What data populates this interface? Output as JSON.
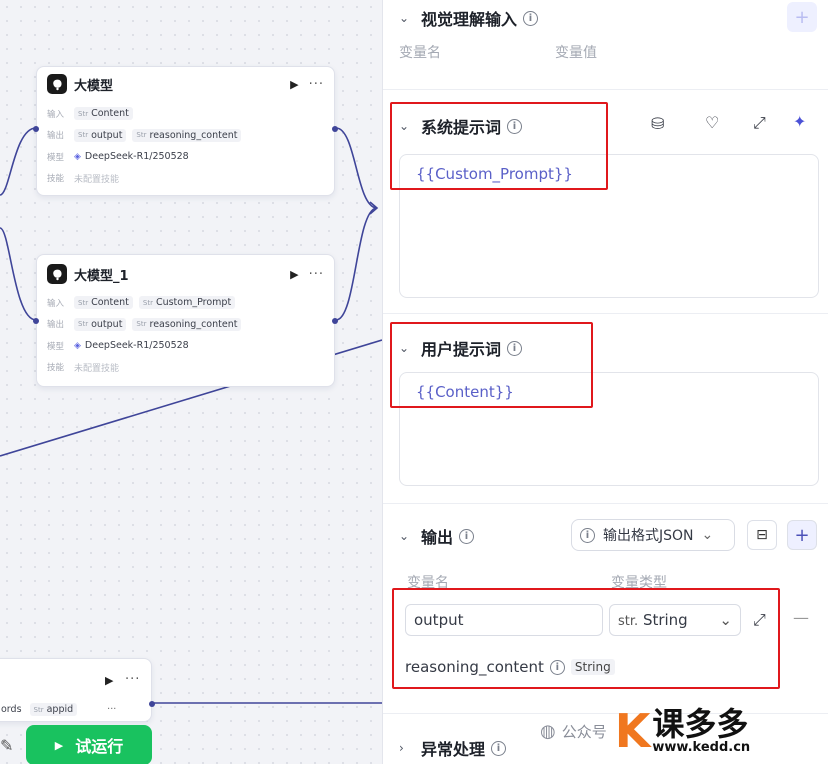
{
  "canvas": {
    "node1": {
      "title": "大模型",
      "row_input_label": "输入",
      "row_output_label": "输出",
      "row_model_label": "模型",
      "row_skill_label": "技能",
      "input_tags": [
        {
          "type": "Str",
          "name": "Content"
        }
      ],
      "output_tags": [
        {
          "type": "Str",
          "name": "output"
        },
        {
          "type": "Str",
          "name": "reasoning_content"
        }
      ],
      "model": "DeepSeek-R1/250528",
      "skill": "未配置技能"
    },
    "node2": {
      "title": "大模型_1",
      "row_input_label": "输入",
      "row_output_label": "输出",
      "row_model_label": "模型",
      "row_skill_label": "技能",
      "input_tags": [
        {
          "type": "Str",
          "name": "Content"
        },
        {
          "type": "Str",
          "name": "Custom_Prompt"
        }
      ],
      "output_tags": [
        {
          "type": "Str",
          "name": "output"
        },
        {
          "type": "Str",
          "name": "reasoning_content"
        }
      ],
      "model": "DeepSeek-R1/250528",
      "skill": "未配置技能"
    },
    "bottom_node": {
      "row_left": "ords",
      "tag": {
        "type": "Str",
        "name": "appid"
      }
    },
    "run_button": "试运行"
  },
  "panel": {
    "vision": {
      "title": "视觉理解输入",
      "col_name": "变量名",
      "col_value": "变量值"
    },
    "system_prompt": {
      "title": "系统提示词",
      "value": "{{Custom_Prompt}}",
      "tools": [
        "library-icon",
        "bulb-icon",
        "expand-icon",
        "sparkle-icon"
      ]
    },
    "user_prompt": {
      "title": "用户提示词",
      "value": "{{Content}}"
    },
    "output": {
      "title": "输出",
      "format_select": "输出格式JSON",
      "col_name": "变量名",
      "col_type": "变量类型",
      "rows": [
        {
          "name": "output",
          "type_prefix": "str.",
          "type": "String"
        }
      ],
      "sub_field": {
        "name": "reasoning_content",
        "type": "String"
      }
    },
    "error": {
      "title": "异常处理"
    }
  },
  "watermark": {
    "text": "公众号",
    "logo_k": "K",
    "logo_text": "课多多",
    "url": "www.kedd.cn"
  },
  "colors": {
    "accent": "#5a60c8",
    "highlight": "#e0181c",
    "run": "#19c25f",
    "wire": "#3f4599"
  }
}
